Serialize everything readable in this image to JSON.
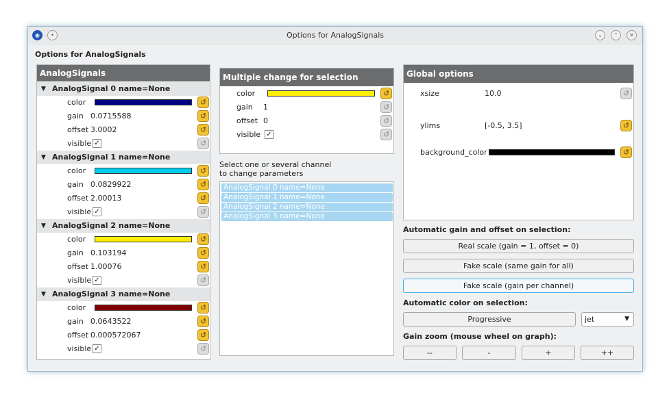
{
  "window": {
    "title": "Options for AnalogSignals",
    "icon": "app-icon"
  },
  "heading": "Options for AnalogSignals",
  "signals_panel": {
    "header": "AnalogSignals",
    "groups": [
      {
        "name": "AnalogSignal 0 name=None",
        "color": "#000080",
        "gain": "0.0715588",
        "offset": "3.0002",
        "visible": true
      },
      {
        "name": "AnalogSignal 1 name=None",
        "color": "#00ccee",
        "gain": "0.0829922",
        "offset": "2.00013",
        "visible": true
      },
      {
        "name": "AnalogSignal 2 name=None",
        "color": "#ffee00",
        "gain": "0.103194",
        "offset": "1.00076",
        "visible": true
      },
      {
        "name": "AnalogSignal 3 name=None",
        "color": "#800000",
        "gain": "0.0643522",
        "offset": "0.000572067",
        "visible": true
      }
    ],
    "labels": {
      "color": "color",
      "gain": "gain",
      "offset": "offset",
      "visible": "visible"
    }
  },
  "multi_panel": {
    "header": "Multiple change for selection",
    "color": "#ffee00",
    "gain": "1",
    "offset": "0",
    "visible": true,
    "labels": {
      "color": "color",
      "gain": "gain",
      "offset": "offset",
      "visible": "visible"
    }
  },
  "select_hint": {
    "line1": "Select one or several channel",
    "line2": "to change parameters"
  },
  "channel_list": [
    "AnalogSignal 0 name=None",
    "AnalogSignal 1 name=None",
    "AnalogSignal 2 name=None",
    "AnalogSignal 3 name=None"
  ],
  "global_panel": {
    "header": "Global options",
    "xsize_label": "xsize",
    "xsize": "10.0",
    "ylims_label": "ylims",
    "ylims": "[-0.5, 3.5]",
    "bg_label": "background_color",
    "bg_color": "#000000"
  },
  "auto_gain": {
    "label": "Automatic gain and offset on selection:",
    "real_scale": "Real scale (gain = 1, offset = 0)",
    "fake_same": "Fake scale (same gain for all)",
    "fake_per": "Fake scale (gain per channel)"
  },
  "auto_color": {
    "label": "Automatic color on selection:",
    "progressive": "Progressive",
    "colormap": "jet"
  },
  "gain_zoom": {
    "label": "Gain zoom (mouse wheel on graph):",
    "b1": "--",
    "b2": "-",
    "b3": "+",
    "b4": "++"
  }
}
